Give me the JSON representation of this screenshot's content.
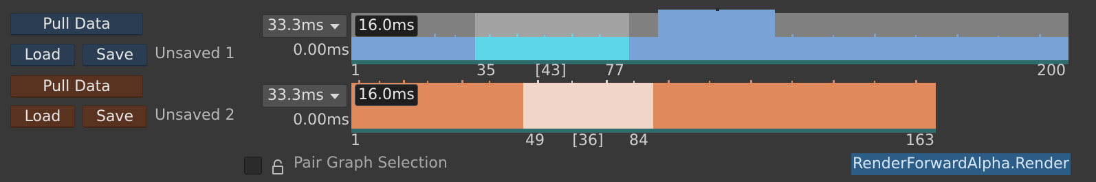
{
  "session1": {
    "pull_label": "Pull Data",
    "load_label": "Load",
    "save_label": "Save",
    "name": "Unsaved 1",
    "scale": "33.3ms",
    "min_label": "0.00ms",
    "selected_value": "16.0ms",
    "ticks": {
      "start": "1",
      "sel_start": "35",
      "range": "[43]",
      "sel_end": "77",
      "end": "200"
    }
  },
  "session2": {
    "pull_label": "Pull Data",
    "load_label": "Load",
    "save_label": "Save",
    "name": "Unsaved 2",
    "scale": "33.3ms",
    "min_label": "0.00ms",
    "selected_value": "16.0ms",
    "ticks": {
      "start": "1",
      "sel_start": "49",
      "range": "[36]",
      "sel_end": "84",
      "end": "163"
    }
  },
  "footer": {
    "pair_label": "Pair Graph Selection",
    "pair_checked": false,
    "marker_name": "RenderForwardAlpha.Render"
  },
  "colors": {
    "blue_bar": "#79a3d6",
    "blue_selected": "#5dd6ea",
    "orange_bar": "#e0895c",
    "orange_selected": "#f2d5c9",
    "teal_baseline": "#2e6d6b"
  }
}
